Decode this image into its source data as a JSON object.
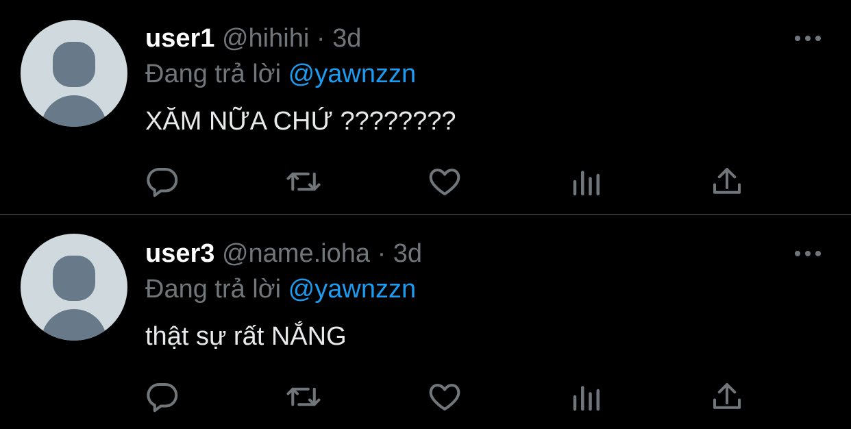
{
  "colors": {
    "background": "#000000",
    "text": "#e7e9ea",
    "muted": "#71767b",
    "link": "#1d9bf0",
    "divider": "#2f3336",
    "avatar_bg": "#cfd9de",
    "avatar_fg": "#68798a"
  },
  "replying_label": "Đang trả lời",
  "tweets": [
    {
      "username": "user1",
      "handle": "@hihihi",
      "separator": "·",
      "time": "3d",
      "reply_to": "@yawnzzn",
      "text": "XĂM NỮA CHỨ ????????",
      "icons": [
        "avatar-placeholder-icon",
        "more-options-icon",
        "reply-icon",
        "retweet-icon",
        "like-icon",
        "views-icon",
        "share-icon"
      ]
    },
    {
      "username": "user3",
      "handle": "@name.ioha",
      "separator": "·",
      "time": "3d",
      "reply_to": "@yawnzzn",
      "text": "thật sự rất NẮNG",
      "icons": [
        "avatar-placeholder-icon",
        "more-options-icon",
        "reply-icon",
        "retweet-icon",
        "like-icon",
        "views-icon",
        "share-icon"
      ]
    }
  ]
}
